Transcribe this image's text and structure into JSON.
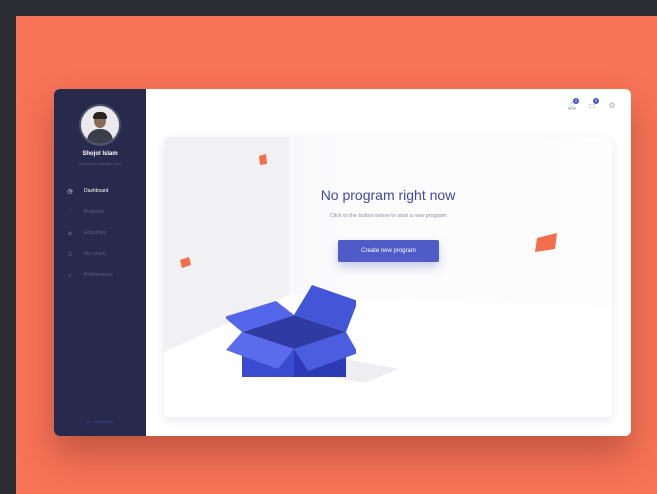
{
  "user": {
    "name": "Shojol Islam",
    "subtitle": "Any text or number here"
  },
  "nav": [
    {
      "label": "Dashboard",
      "icon": "dashboard-icon",
      "active": true
    },
    {
      "label": "Progress",
      "icon": "progress-icon",
      "active": false
    },
    {
      "label": "Education",
      "icon": "education-icon",
      "active": false
    },
    {
      "label": "My coach",
      "icon": "coach-icon",
      "active": false
    },
    {
      "label": "Performance",
      "icon": "performance-icon",
      "active": false
    }
  ],
  "header": {
    "notification_count": "2",
    "cart_count": "0"
  },
  "empty_state": {
    "title": "No program right now",
    "subtitle": "Click to the button below to start a new program",
    "cta_label": "Create new program"
  },
  "colors": {
    "page_background": "#f87357",
    "sidebar": "#272a4d",
    "accent": "#4f5bc6",
    "confetti": "#f26e4c"
  }
}
